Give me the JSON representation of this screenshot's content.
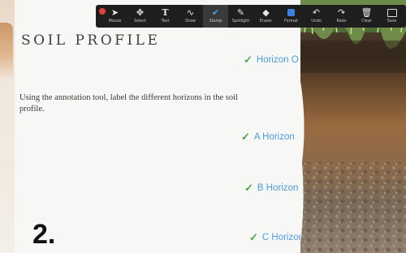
{
  "slide": {
    "title": "SOIL PROFILE",
    "instructions": "Using the annotation tool, label the different horizons in the soil profile.",
    "number": "2."
  },
  "labels": [
    {
      "check": "✓",
      "text": "Horizon O"
    },
    {
      "check": "✓",
      "text": "A Horizon"
    },
    {
      "check": "✓",
      "text": "B Horizon"
    },
    {
      "check": "✓",
      "text": "C Horizon"
    }
  ],
  "toolbar": {
    "tools": [
      {
        "label": "Mouse",
        "icon": "cursor-icon"
      },
      {
        "label": "Select",
        "icon": "move-icon"
      },
      {
        "label": "Text",
        "icon": "text-icon"
      },
      {
        "label": "Draw",
        "icon": "squiggle-icon"
      },
      {
        "label": "Stamp",
        "icon": "checkmark-icon"
      },
      {
        "label": "Spotlight",
        "icon": "spotlight-icon"
      },
      {
        "label": "Eraser",
        "icon": "eraser-icon"
      },
      {
        "label": "Format",
        "icon": "format-icon"
      },
      {
        "label": "Undo",
        "icon": "undo-icon"
      },
      {
        "label": "Redo",
        "icon": "redo-icon"
      },
      {
        "label": "Clear",
        "icon": "trash-icon"
      },
      {
        "label": "Save",
        "icon": "save-icon"
      }
    ],
    "active_tool": "Stamp"
  },
  "colors": {
    "label_text": "#4b9de0",
    "check": "#4aa84a",
    "toolbar_bg": "#1e1e1e",
    "close_button": "#e8413a",
    "format_swatch": "#3b7fe0"
  }
}
